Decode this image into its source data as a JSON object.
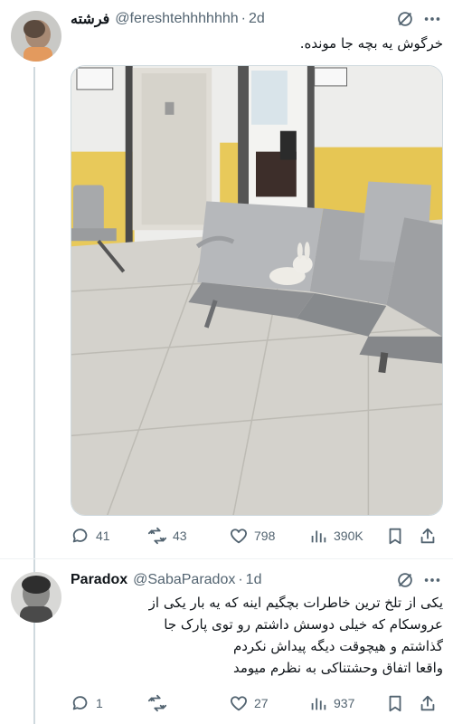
{
  "tweets": [
    {
      "display_name": "فرشته",
      "handle": "@fereshtehhhhhhh",
      "separator": "·",
      "time": "2d",
      "text": "خرگوش یه بچه جا مونده.",
      "media": {
        "description_icon": "photo"
      },
      "actions": {
        "replies": "41",
        "reposts": "43",
        "likes": "798",
        "views": "390K"
      }
    },
    {
      "display_name": "Paradox",
      "handle": "@SabaParadox",
      "separator": "·",
      "time": "1d",
      "text_lines": [
        "یکی از تلخ ترین خاطرات بچگیم اینه که یه بار یکی از",
        "عروسکام که خیلی دوسش داشتم رو توی پارک جا",
        "گذاشتم و هیچوقت دیگه پیداش نکردم",
        "واقعا اتفاق وحشتناکی به نظرم میومد"
      ],
      "actions": {
        "replies": "1",
        "reposts": "",
        "likes": "27",
        "views": "937"
      }
    }
  ],
  "colors": {
    "text_primary": "#0f1419",
    "text_secondary": "#536471",
    "border": "#cfd9de",
    "wall_yellow": "#e8c95a"
  }
}
